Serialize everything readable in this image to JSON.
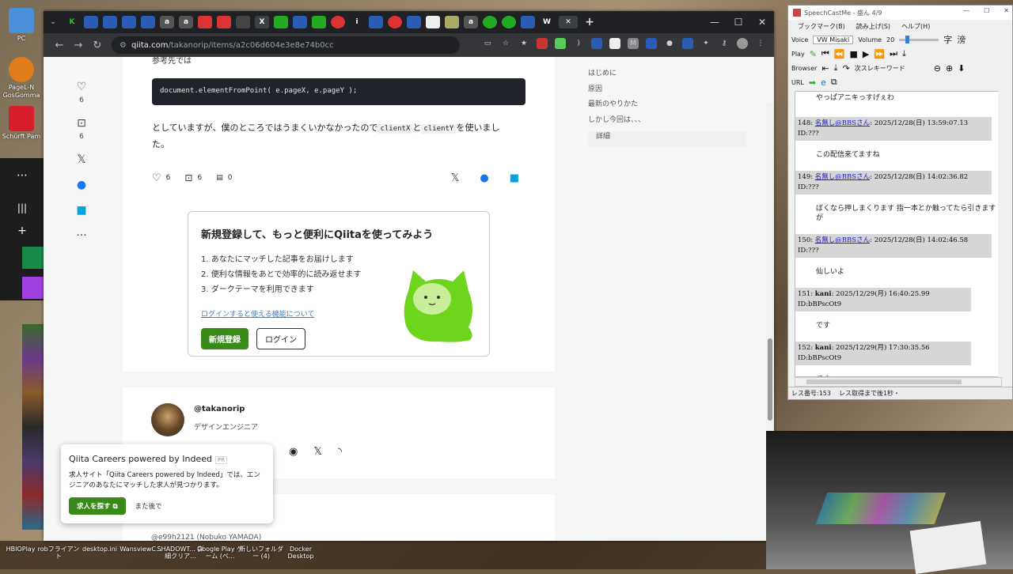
{
  "desktop": {
    "top_left_icon_label": "PC",
    "left_icons": [
      {
        "label": "PageL-N GosGomma"
      },
      {
        "label": "Schürft Pam"
      }
    ],
    "bottom_icons": [
      {
        "label": "HBIOPlay"
      },
      {
        "label": "robフライアン ト"
      },
      {
        "label": "desktop.ini"
      },
      {
        "label": "WansviewC..."
      },
      {
        "label": "SHADOWT... 詳細クリア..."
      },
      {
        "label": "Google Play ゲーム (ベ..."
      },
      {
        "label": "新しいフォルダ ー (4)"
      },
      {
        "label": "Docker Desktop"
      }
    ]
  },
  "browser": {
    "url_host": "qiita.com",
    "url_path": "/takanorip/items/a2c06d604e3e8e74b0cc",
    "window_controls": [
      "—",
      "☐",
      "✕"
    ],
    "new_tab": "+"
  },
  "article": {
    "heading_fragment": "参考先では",
    "code": "document.elementFromPoint( e.pageX, e.pageY );",
    "para_before": "としていますが、僕のところではうまくいかなかったので",
    "code_x": "clientX",
    "para_to": "と",
    "code_y": "clientY",
    "para_after": "を使いました。",
    "like_count": "6",
    "stock_count": "6",
    "comment_count": "0"
  },
  "sidebar": {
    "like_count": "6",
    "stock_count": "6"
  },
  "signup": {
    "title": "新規登録して、もっと便利にQiitaを使ってみよう",
    "items": [
      "1. あなたにマッチした記事をお届けします",
      "2. 便利な情報をあとで効率的に読み返せます",
      "3. ダークテーマを利用できます"
    ],
    "link": "ログインすると使える機能について",
    "register_button": "新規登録",
    "login_button": "ログイン"
  },
  "author": {
    "handle": "@takanorip",
    "role": "デザインエンジニア"
  },
  "next_user": "@e99h2121 (Nobuko YAMADA)",
  "toc": [
    "はじめに",
    "原因",
    "最新のやりかた",
    "しかし今回は、、、",
    "詳細"
  ],
  "careers": {
    "title": "Qiita Careers powered by Indeed",
    "pr": "PR",
    "desc": "求人サイト「Qiita Careers powered by Indeed」では、エンジニアのあなたにマッチした求人が見つかります。",
    "cta": "求人を探す",
    "later": "また後で"
  },
  "speechcast": {
    "title": "SpeechCastMe - 盛ん 4/9",
    "menu": [
      "ブックマーク(B)",
      "読み上げ(S)",
      "ヘルプ(H)"
    ],
    "voice_label": "Voice",
    "voice_value": "VW Misaki",
    "volume_label": "Volume",
    "volume_value": "20",
    "play_label": "Play",
    "browser_label": "Browser",
    "url_label": "URL",
    "keyword_label": "次スレキーワード",
    "top_line": "やっぱアニキっすげぇわ",
    "messages": [
      {
        "num": "148:",
        "name": "名無し@BBSさん",
        "date": ": 2025/12/28(日) 13:59:07.13",
        "id": "ID:???",
        "body": "この配信来てますね"
      },
      {
        "num": "149:",
        "name": "名無し@BBSさん",
        "date": ": 2025/12/28(日) 14:02:36.82",
        "id": "ID:???",
        "body": "ぼくなら押しまくります 指一本とか触ってたら引きますが"
      },
      {
        "num": "150:",
        "name": "名無し@BBSさん",
        "date": ": 2025/12/28(日) 14:02:46.58",
        "id": "ID:???",
        "body": "仙しいよ"
      },
      {
        "num": "151:",
        "name": "kani",
        "date": ": 2025/12/29(月) 16:40:25.99 ID:bBPscOt9",
        "id": "",
        "body": "です"
      },
      {
        "num": "152:",
        "name": "kani",
        "date": ": 2025/12/29(月) 17:30:35.56 ID:bBPscOt9",
        "id": "",
        "body": "です"
      }
    ],
    "status_left": "レス番号:153",
    "status_right": "レス取得まで後1秒・"
  }
}
